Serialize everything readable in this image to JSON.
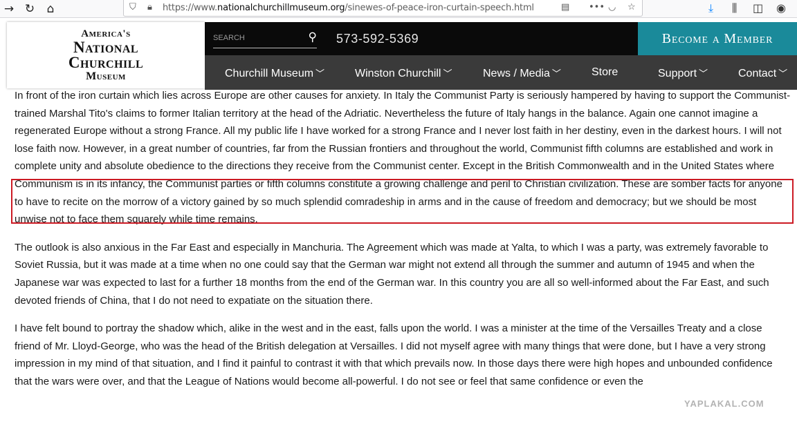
{
  "browser": {
    "url_prefix": "https://www.",
    "url_domain": "nationalchurchillmuseum.org",
    "url_path": "/sinewes-of-peace-iron-curtain-speech.html"
  },
  "site": {
    "logo": {
      "line1": "America's",
      "line2": "National",
      "line3": "Churchill",
      "line4": "Museum"
    },
    "search_placeholder": "SEARCH",
    "phone": "573-592-5369",
    "member_button": "Become a Member",
    "nav": [
      {
        "label": "Churchill Museum",
        "has_menu": true
      },
      {
        "label": "Winston Churchill",
        "has_menu": true
      },
      {
        "label": "News / Media",
        "has_menu": true
      },
      {
        "label": "Store",
        "has_menu": false
      },
      {
        "label": "Support",
        "has_menu": true
      },
      {
        "label": "Contact",
        "has_menu": true
      }
    ]
  },
  "article": {
    "p1_before": "In front of the iron curtain which lies across Europe are other causes for anxiety. In Italy the Communist Party is seriously hampered by having to support the Communist-trained Marshal Tito's claims to former Italian territory at the head of the Adriatic. Nevertheless the future of Italy hangs in the balance. Again one cannot imagine a regenerated Europe without a strong France. All my public life I have worked for a strong France and I never lost faith in her destiny, even in the darkest hours. I will not lose faith now. However, in a great number of countries, far from the Russian frontiers and throughout the world, Communist fifth columns are established and work in complete unity and absolute obedience to the directions they receive from the Communist center. Except in the British",
    "p1_highlight": "Commonwealth and in the United States where Communism is in its infancy, the Communist parties or fifth columns constitute a growing challenge and peril to Christian civilization. These are somber facts for anyone to have to recite on the morrow of a victory gained by so much splendid comradeship in arms and in the cause of freedom and democracy; but we should be most unwise not to face them squarely while time remains.",
    "p2": "The outlook is also anxious in the Far East and especially in Manchuria. The Agreement which was made at Yalta, to which I was a party, was extremely favorable to Soviet Russia, but it was made at a time when no one could say that the German war might not extend all through the summer and autumn of 1945 and when the Japanese war was expected to last for a further 18 months from the end of the German war. In this country you are all so well-informed about the Far East, and such devoted friends of China, that I do not need to expatiate on the situation there.",
    "p3": "I have felt bound to portray the shadow which, alike in the west and in the east, falls upon the world. I was a minister at the time of the Versailles Treaty and a close friend of Mr. Lloyd-George, who was the head of the British delegation at Versailles. I did not myself agree with many things that were done, but I have a very strong impression in my mind of that situation, and I find it painful to contrast it with that which prevails now. In those days there were high hopes and unbounded confidence that the wars were over, and that the League of Nations would become all-powerful. I do not see or feel that same confidence or even the"
  },
  "watermark": "YAPLAKAL.COM",
  "colors": {
    "member_bg": "#1a8a9a",
    "highlight_border": "#cc1a24",
    "navbar_bg": "#3a3a3a"
  }
}
